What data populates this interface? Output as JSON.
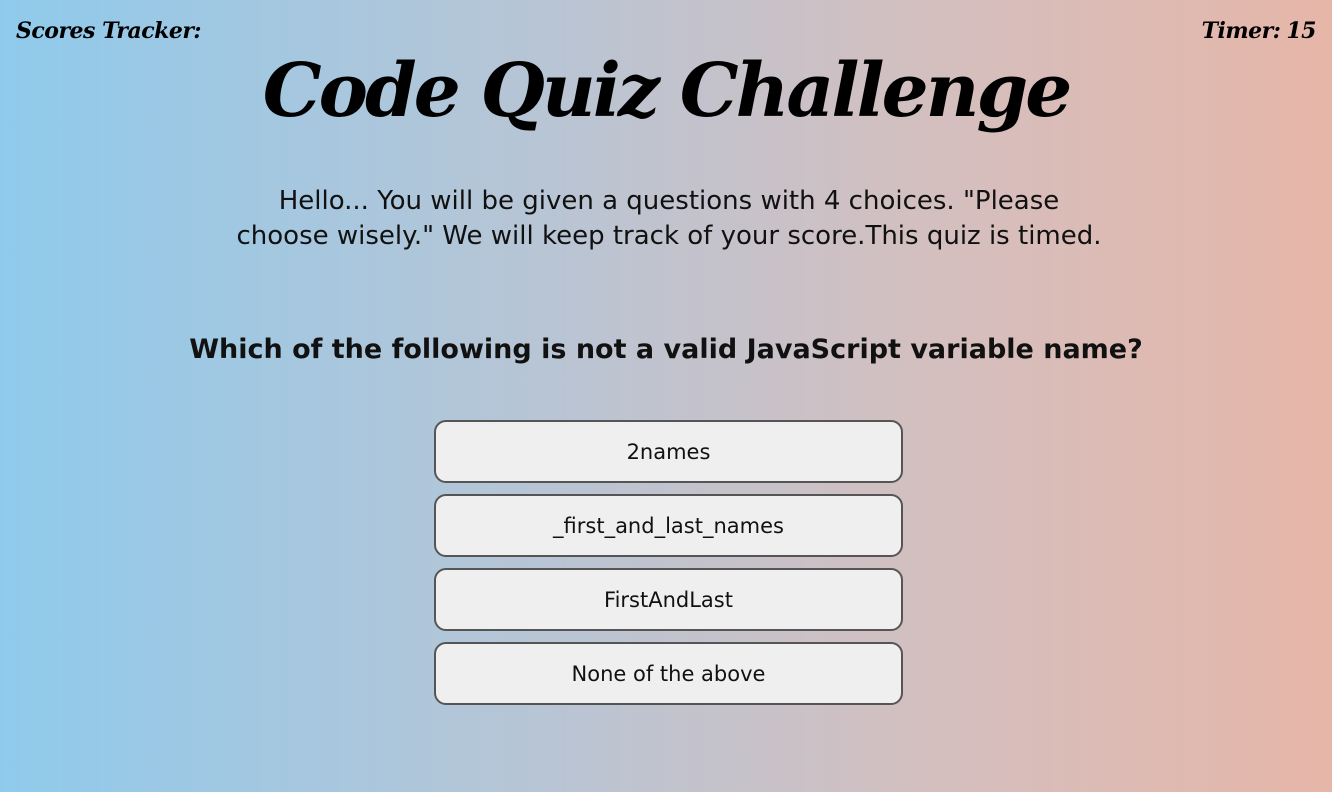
{
  "header": {
    "scores_label": "Scores Tracker:",
    "timer_label": "Timer:",
    "timer_value": "15"
  },
  "main": {
    "title": "Code Quiz Challenge",
    "intro": "Hello... You will be given a questions with 4 choices. \"Please choose wisely.\" We will keep track of your score.This quiz is timed.",
    "question": "Which of the following is not a valid JavaScript variable name?",
    "choices": [
      {
        "label": "2names"
      },
      {
        "label": "_first_and_last_names"
      },
      {
        "label": "FirstAndLast"
      },
      {
        "label": "None of the above"
      }
    ]
  },
  "colors": {
    "gradient_left": "#8fcaec",
    "gradient_right": "#e6b6a8",
    "button_bg": "#efefef",
    "button_border": "#555555"
  }
}
